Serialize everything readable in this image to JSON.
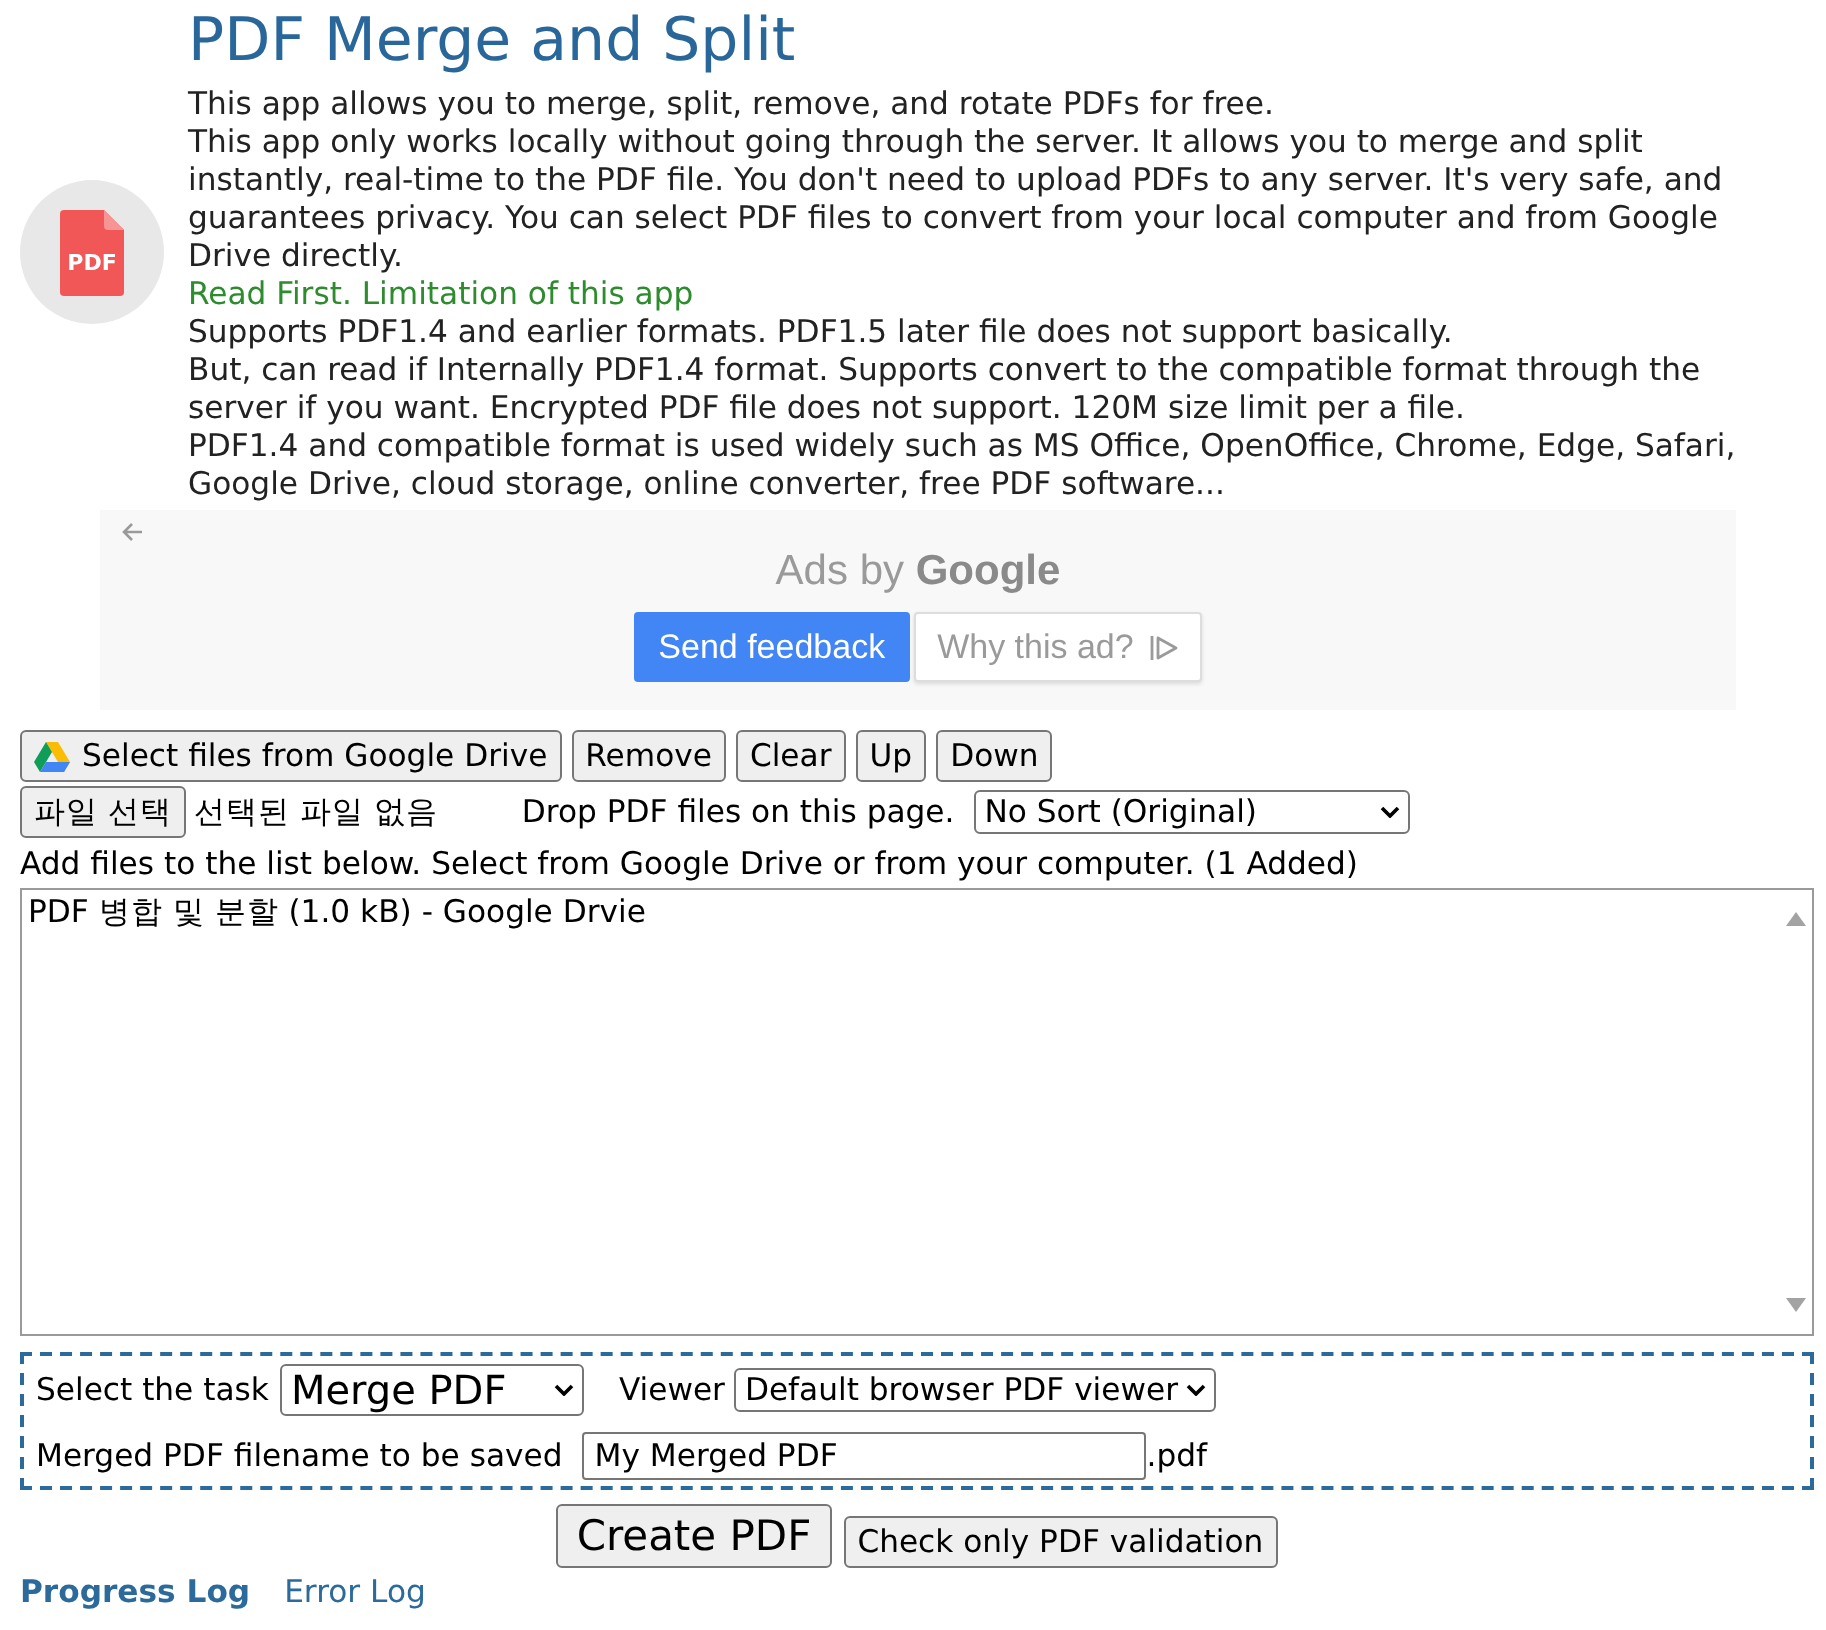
{
  "header": {
    "logo_label": "PDF",
    "title": "PDF Merge and Split",
    "intro": [
      "This app allows you to merge, split, remove, and rotate PDFs for free.",
      "This app only works locally without going through the server. It allows you to merge and split instantly, real-time to the PDF file. You don't need to upload PDFs to any server. It's very safe, and guarantees privacy. You can select PDF files to convert from your local computer and from Google Drive directly."
    ],
    "limitation_link": "Read First. Limitation of this app",
    "notes": [
      "Supports PDF1.4 and earlier formats. PDF1.5 later file does not support basically.",
      "But, can read if Internally PDF1.4 format. Supports convert to the compatible format through the server if you want. Encrypted PDF file does not support. 120M size limit per a file.",
      "PDF1.4 and compatible format is used widely such as MS Office, OpenOffice, Chrome, Edge, Safari, Google Drive, cloud storage, online converter, free PDF software..."
    ]
  },
  "ad": {
    "attribution": "Ads by **Google**",
    "buttons": [
      {
        "label": "Send feedback",
        "kind": "primary"
      },
      {
        "label": "Why this ad?",
        "kind": "info"
      }
    ]
  },
  "toolbar": [
    {
      "label": "Select files from Google Drive",
      "kind": "drive"
    },
    {
      "label": "Remove",
      "kind": "plain"
    },
    {
      "label": "Clear",
      "kind": "plain"
    },
    {
      "label": "Up",
      "kind": "plain"
    },
    {
      "label": "Down",
      "kind": "plain"
    }
  ],
  "file_input": {
    "button": "파일 선택",
    "status": "선택된 파일 없음"
  },
  "drop_hint": "Drop PDF files on this page.",
  "sort_select": {
    "value": "No Sort (Original)"
  },
  "list_caption": "Add files to the list below. Select from Google Drive or from your computer. (1 Added)",
  "file_list": {
    "items": [
      {
        "label": "PDF 병합 및 분할 (1.0 kB) - Google Drvie",
        "selected": false
      }
    ]
  },
  "options": {
    "task_label": "Select the task",
    "task_select": "Merge PDF",
    "viewer_label": "Viewer",
    "viewer_select": "Default browser PDF viewer",
    "filename_label": "Merged PDF filename to be saved",
    "filename_value": "My Merged PDF",
    "filename_suffix": ".pdf"
  },
  "actions": [
    {
      "label": "Create PDF",
      "kind": "primary"
    },
    {
      "label": "Check only PDF validation",
      "kind": "secondary"
    }
  ],
  "log_tabs": [
    {
      "label": "Progress Log",
      "selected": true
    },
    {
      "label": "Error Log",
      "selected": false
    }
  ]
}
